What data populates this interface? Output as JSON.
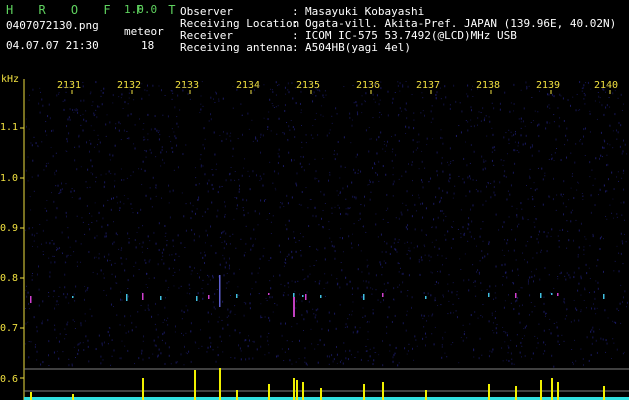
{
  "header": {
    "app_title": "H R O F F T",
    "app_version": "1.0.0",
    "filename": "0407072130.png",
    "meteor_label": "meteor",
    "datetime": "04.07.07 21:30",
    "meteor_count": "18",
    "info": [
      {
        "label": "Observer",
        "sep": ":",
        "value": "Masayuki Kobayashi"
      },
      {
        "label": "Receiving Location",
        "sep": ":",
        "value": "Ogata-vill. Akita-Pref. JAPAN (139.96E, 40.02N)"
      },
      {
        "label": "Receiver",
        "sep": ":",
        "value": "ICOM IC-575 53.7492(@LCD)MHz USB"
      },
      {
        "label": "Receiving antenna",
        "sep": ":",
        "value": "A504HB(yagi 4el)"
      }
    ]
  },
  "spectrogram": {
    "unit": "kHz",
    "time_labels": [
      "2131",
      "2132",
      "2133",
      "2134",
      "2135",
      "2136",
      "2137",
      "2138",
      "2139",
      "2140"
    ],
    "freq_labels": [
      "1.1",
      "1.0",
      "0.9",
      "0.8",
      "0.7",
      "0.6"
    ],
    "colors": {
      "axis": "#f0e040",
      "background": "#000000",
      "noise": "#1c1c6a",
      "meteor_bar": "#f0f000",
      "baseline": "#30e0e0"
    }
  }
}
